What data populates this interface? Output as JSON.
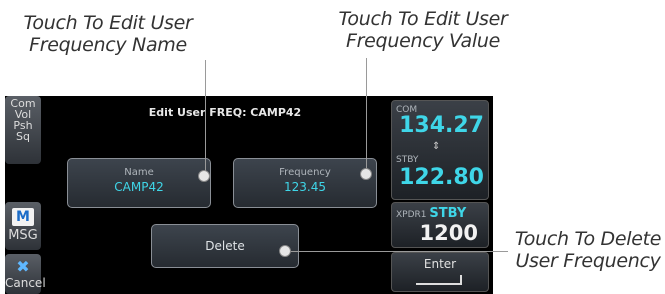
{
  "callouts": {
    "edit_name": [
      "Touch To Edit User",
      "Frequency Name"
    ],
    "edit_value": [
      "Touch To Edit User",
      "Frequency Value"
    ],
    "delete": [
      "Touch To Delete",
      "User Frequency"
    ]
  },
  "screen": {
    "title": "Edit User FREQ: CAMP42",
    "left_panel": {
      "com_vol": "Com Vol",
      "psh_sq": "Psh Sq",
      "msg_label": "MSG",
      "msg_icon": "M",
      "cancel_label": "Cancel"
    },
    "name_button": {
      "label": "Name",
      "value": "CAMP42"
    },
    "frequency_button": {
      "label": "Frequency",
      "value": "123.45"
    },
    "delete_button": {
      "label": "Delete"
    },
    "right_panel": {
      "com_label": "COM",
      "com_freq": "134.27",
      "stby_label": "STBY",
      "stby_freq": "122.80",
      "xpdr_label": "XPDR1",
      "xpdr_mode": "STBY",
      "xpdr_code": "1200",
      "enter_label": "Enter"
    }
  },
  "colors": {
    "cyan": "#3fd6e8",
    "background": "#000000"
  }
}
